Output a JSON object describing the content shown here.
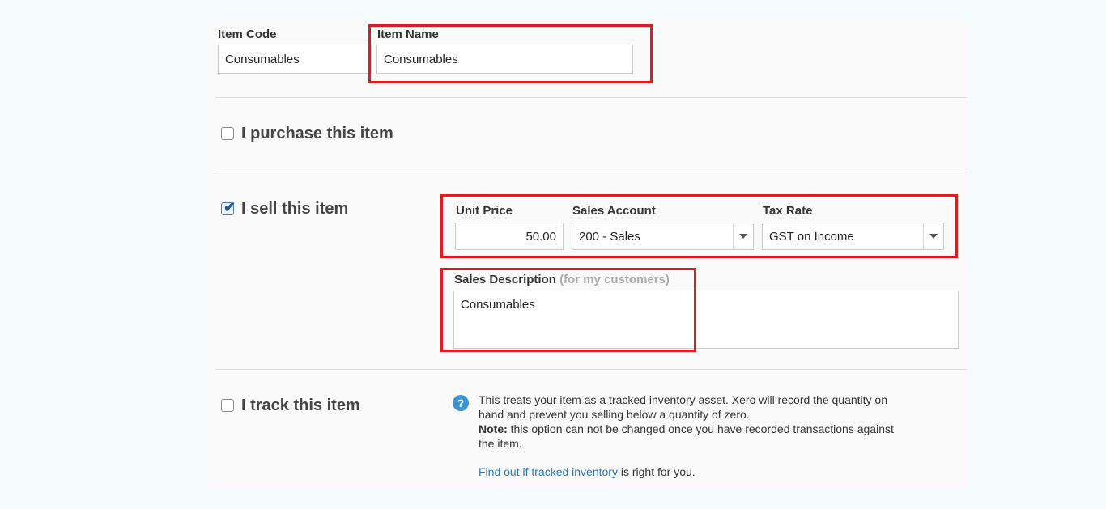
{
  "item": {
    "code_label": "Item Code",
    "code_value": "Consumables",
    "name_label": "Item Name",
    "name_value": "Consumables"
  },
  "purchase": {
    "label": "I purchase this item",
    "checked": false
  },
  "sell": {
    "label": "I sell this item",
    "checked": true,
    "unit_price_label": "Unit Price",
    "unit_price_value": "50.00",
    "sales_account_label": "Sales Account",
    "sales_account_value": "200 - Sales",
    "tax_rate_label": "Tax Rate",
    "tax_rate_value": "GST on Income",
    "description_label": "Sales Description",
    "description_hint": "(for my customers)",
    "description_value": "Consumables"
  },
  "track": {
    "label": "I track this item",
    "checked": false,
    "help_icon": "question-icon",
    "help_glyph": "?",
    "info_line1": "This treats your item as a tracked inventory asset. Xero will record the quantity on",
    "info_line2": "hand and prevent you selling below a quantity of zero.",
    "note_label": "Note:",
    "note_text": " this option can not be changed once you have recorded transactions against",
    "note_line2": "the item.",
    "link_text": "Find out if tracked inventory",
    "link_suffix": " is right for you."
  },
  "colors": {
    "highlight": "#e01b24",
    "link": "#1f7ac3",
    "help_icon": "#3a93cf"
  }
}
